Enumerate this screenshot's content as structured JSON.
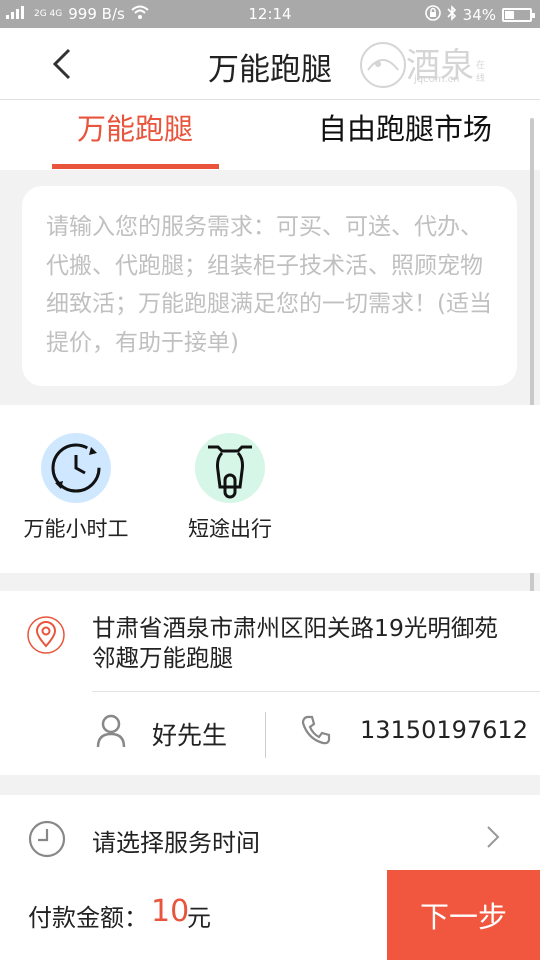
{
  "status_bar": {
    "network": "2G 4G",
    "speed": "999 B/s",
    "time": "12:14",
    "battery": "34%",
    "battery_level": 0.34
  },
  "header": {
    "title": "万能跑腿",
    "logo_text": "酒泉",
    "logo_sub": "jqcom.cn",
    "logo_tag": "在线"
  },
  "tabs": [
    {
      "label": "万能跑腿",
      "active": true
    },
    {
      "label": "自由跑腿市场",
      "active": false
    }
  ],
  "request": {
    "placeholder": "请输入您的服务需求：可买、可送、代办、代搬、代跑腿；组装柜子技术活、照顾宠物细致活；万能跑腿满足您的一切需求！(适当提价，有助于接单)"
  },
  "services": [
    {
      "label": "万能小时工",
      "icon": "clock-cycle-icon"
    },
    {
      "label": "短途出行",
      "icon": "scooter-icon"
    }
  ],
  "address": {
    "text": "甘肃省酒泉市肃州区阳关路19光明御苑邻趣万能跑腿",
    "contact_name": "好先生",
    "contact_phone": "13150197612"
  },
  "service_time": {
    "label": "请选择服务时间"
  },
  "payment": {
    "label": "付款金额：",
    "amount": "10",
    "unit": "元",
    "next_button": "下一步"
  },
  "colors": {
    "accent": "#e8553c",
    "button": "#f0573e"
  }
}
